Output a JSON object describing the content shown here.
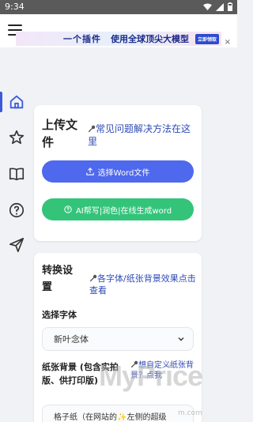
{
  "status_bar": {
    "time": "9:34"
  },
  "banner": {
    "text1": "一个插件",
    "text2": "使用全球顶尖大模型",
    "cta": "立即领取"
  },
  "nav": {
    "items": [
      "home",
      "favorites",
      "book",
      "help",
      "send"
    ]
  },
  "upload_card": {
    "title": "上传文件",
    "faq_link": "常见问题解决方法在这里",
    "upload_button": "选择Word文件",
    "ai_button": "AI帮写|润色|在线生成word"
  },
  "settings_card": {
    "title": "转换设置",
    "effect_link": "各字体/纸张背景效果点击查看",
    "font_label": "选择字体",
    "font_value": "新叶念体",
    "paper_label": "纸张背景 (包含实拍版、供打印版)",
    "custom_link": "想自定义纸张背景？点我",
    "paper_value": "格子纸（在网站的✨左侧的超级"
  },
  "watermark": {
    "main": "MyPrice",
    "sub": "m.com"
  },
  "colors": {
    "primary": "#4e68ee",
    "ai_green": "#33c47a",
    "link": "#2f4bb6",
    "nav_active": "#3b5bdb"
  }
}
